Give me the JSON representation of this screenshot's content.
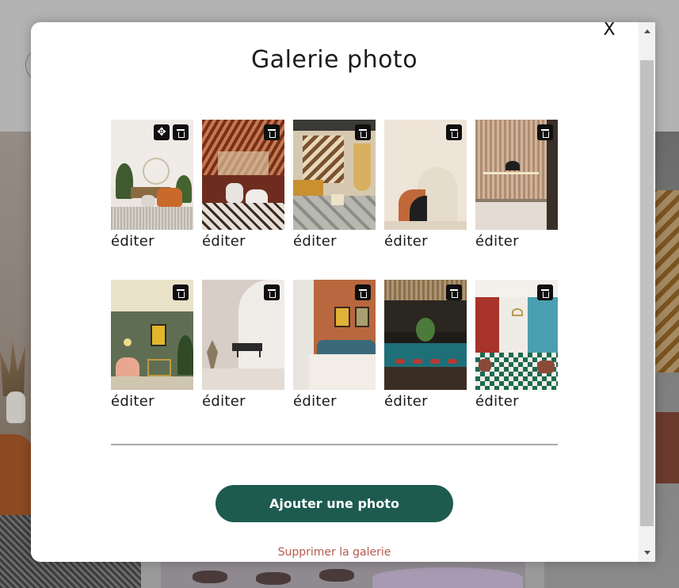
{
  "modal": {
    "title": "Galerie photo",
    "close_label": "X",
    "add_button_label": "Ajouter une photo",
    "delete_gallery_label": "Supprimer la galerie"
  },
  "gallery": {
    "edit_label": "éditer",
    "photos": [
      {
        "subject": "living room with orange armchair and plants",
        "icons": [
          "move-icon",
          "trash-icon"
        ]
      },
      {
        "subject": "greenhouse restaurant with white chairs",
        "icons": [
          "trash-icon"
        ]
      },
      {
        "subject": "sunlit room with hanging rattan chair",
        "icons": [
          "trash-icon"
        ]
      },
      {
        "subject": "beige wall with terracotta arch shapes",
        "icons": [
          "trash-icon"
        ]
      },
      {
        "subject": "wood-paneled kitchen with wall lamp",
        "icons": [
          "trash-icon"
        ]
      },
      {
        "subject": "green lounge with pink armchair",
        "icons": [
          "trash-icon"
        ]
      },
      {
        "subject": "white arched room with black bench",
        "icons": [
          "trash-icon"
        ]
      },
      {
        "subject": "terracotta wall bedroom with framed posters",
        "icons": [
          "trash-icon"
        ]
      },
      {
        "subject": "dark bar with teal counter and red stools",
        "icons": [
          "trash-icon"
        ]
      },
      {
        "subject": "red restaurant hall with checkered floor",
        "icons": [
          "trash-icon"
        ]
      }
    ]
  },
  "colors": {
    "primary_button": "#1e5b4f",
    "delete_link": "#b65a51",
    "divider": "#a9a9a9"
  }
}
